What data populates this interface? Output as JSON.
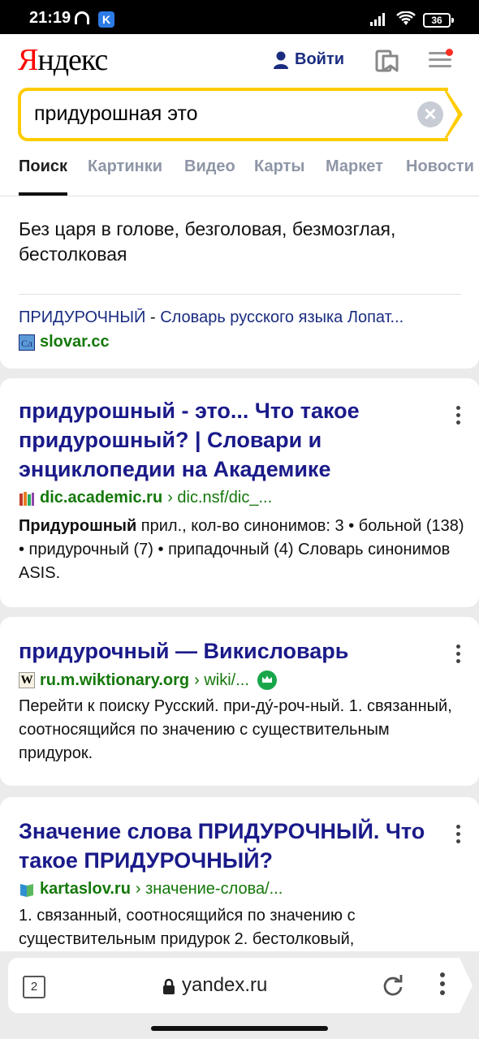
{
  "status_bar": {
    "time": "21:19",
    "app_badge": "K",
    "battery": "36"
  },
  "header": {
    "logo": {
      "first_letter": "Я",
      "rest": "ндекс"
    },
    "login_label": "Войти"
  },
  "search": {
    "query": "придурошная это"
  },
  "nav_tabs": [
    "Поиск",
    "Картинки",
    "Видео",
    "Карты",
    "Маркет",
    "Новости"
  ],
  "dictionary_card": {
    "snippet": "Без царя в голове, безголовая, безмозглая, бестолковая",
    "source_word": "ПРИДУРОЧНЫЙ",
    "source_sep": " - ",
    "source_title": "Словарь русского языка Лопат...",
    "host": "slovar.cc",
    "favicon_text": "Сл"
  },
  "results": [
    {
      "title": "придурошный - это... Что такое придурошный? | Словари и энциклопедии на Академике",
      "host": "dic.academic.ru",
      "path": "› dic.nsf/dic_...",
      "text_bold": "Придурошный",
      "text": " прил., кол-во синонимов: 3 • больной (138) • придурочный (7) • припадочный (4) Словарь синонимов ASIS."
    },
    {
      "title": "придурочный — Викисловарь",
      "host": "ru.m.wiktionary.org",
      "path": "› wiki/...",
      "favicon_text": "W",
      "text": "Перейти к поиску Русский. при-ду́-роч-ный. 1. связанный, соотносящийся по значению с существительным придурок."
    },
    {
      "title": "Значение слова ПРИДУРОЧНЫЙ. Что такое ПРИДУРОЧНЫЙ?",
      "host": "kartaslov.ru",
      "path": "› значение-слова/...",
      "text": "1. связанный, соотносящийся по значению с существительным придурок 2. бестолковый,"
    }
  ],
  "bottom_bar": {
    "tab_count": "2",
    "url": "yandex.ru"
  },
  "colors": {
    "accent_yellow": "#ffcc00",
    "link_blue": "#1a1a8a",
    "host_green": "#14780a",
    "logo_red": "#ff0000"
  }
}
